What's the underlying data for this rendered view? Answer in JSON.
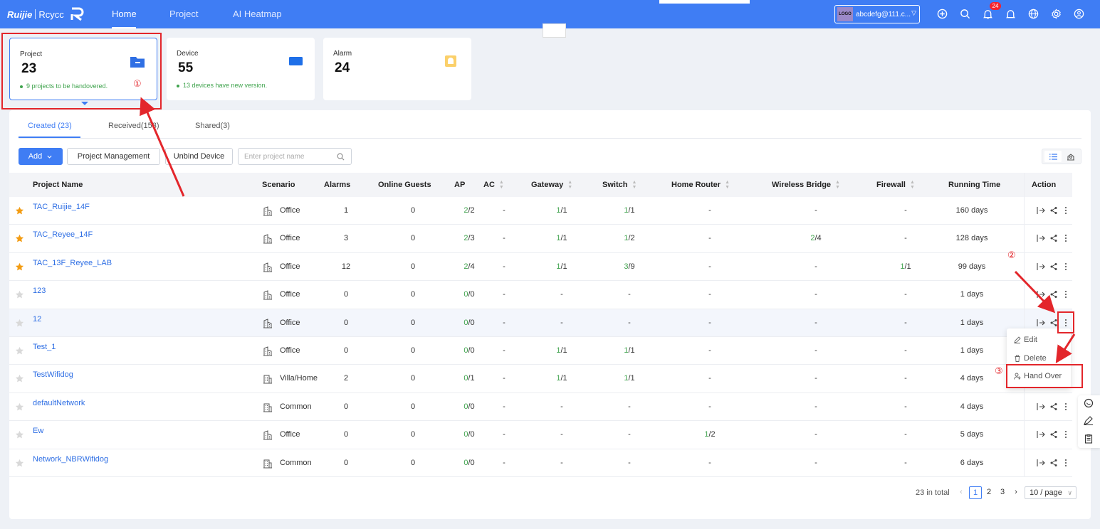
{
  "brand": {
    "ruijie": "Ruijie",
    "reyee": "Rcycc"
  },
  "nav": {
    "tabs": [
      {
        "label": "Home"
      },
      {
        "label": "Project"
      },
      {
        "label": "AI Heatmap"
      }
    ]
  },
  "account": {
    "logo": "LOGO",
    "name": "abcdefg@111.c..."
  },
  "notifications": {
    "count": "24"
  },
  "cards": [
    {
      "label": "Project",
      "value": "23",
      "note": "9 projects to be handovered.",
      "icon": "folder-icon"
    },
    {
      "label": "Device",
      "value": "55",
      "note": "13 devices have new version.",
      "icon": "device-icon"
    },
    {
      "label": "Alarm",
      "value": "24",
      "note": "",
      "icon": "alarm-bell-icon"
    }
  ],
  "tabs": [
    {
      "label": "Created (23)"
    },
    {
      "label": "Received(153)"
    },
    {
      "label": "Shared(3)"
    }
  ],
  "toolbar": {
    "add": "Add",
    "project_management": "Project Management",
    "unbind_device": "Unbind Device",
    "search_placeholder": "Enter project name"
  },
  "table": {
    "headers": {
      "project_name": "Project Name",
      "scenario": "Scenario",
      "alarms": "Alarms",
      "online_guests": "Online Guests",
      "ap": "AP",
      "ac": "AC",
      "gateway": "Gateway",
      "switch": "Switch",
      "home_router": "Home Router",
      "wireless_bridge": "Wireless Bridge",
      "firewall": "Firewall",
      "running_time": "Running Time",
      "action": "Action"
    },
    "rows": [
      {
        "starred": true,
        "name": "TAC_Ruijie_14F",
        "scenario": "Office",
        "alarms": "1",
        "guests": "0",
        "ap": [
          "2",
          "/2"
        ],
        "ac": "-",
        "gateway": [
          "1",
          "/1"
        ],
        "switch": [
          "1",
          "/1"
        ],
        "home_router": [
          "-",
          ""
        ],
        "bridge": [
          "-",
          ""
        ],
        "firewall": [
          "-",
          ""
        ],
        "running": "160 days"
      },
      {
        "starred": true,
        "name": "TAC_Reyee_14F",
        "scenario": "Office",
        "alarms": "3",
        "guests": "0",
        "ap": [
          "2",
          "/3"
        ],
        "ac": "-",
        "gateway": [
          "1",
          "/1"
        ],
        "switch": [
          "1",
          "/2"
        ],
        "home_router": [
          "-",
          ""
        ],
        "bridge": [
          "2",
          "/4"
        ],
        "firewall": [
          "-",
          ""
        ],
        "running": "128 days"
      },
      {
        "starred": true,
        "name": "TAC_13F_Reyee_LAB",
        "scenario": "Office",
        "alarms": "12",
        "guests": "0",
        "ap": [
          "2",
          "/4"
        ],
        "ac": "-",
        "gateway": [
          "1",
          "/1"
        ],
        "switch": [
          "3",
          "/9"
        ],
        "home_router": [
          "-",
          ""
        ],
        "bridge": [
          "-",
          ""
        ],
        "firewall": [
          "1",
          "/1"
        ],
        "running": "99 days"
      },
      {
        "starred": false,
        "name": "123",
        "scenario": "Office",
        "alarms": "0",
        "guests": "0",
        "ap": [
          "0",
          "/0"
        ],
        "ac": "-",
        "gateway": [
          "-",
          ""
        ],
        "switch": [
          "-",
          ""
        ],
        "home_router": [
          "-",
          ""
        ],
        "bridge": [
          "-",
          ""
        ],
        "firewall": [
          "-",
          ""
        ],
        "running": "1 days"
      },
      {
        "starred": false,
        "name": "12",
        "scenario": "Office",
        "alarms": "0",
        "guests": "0",
        "ap": [
          "0",
          "/0"
        ],
        "ac": "-",
        "gateway": [
          "-",
          ""
        ],
        "switch": [
          "-",
          ""
        ],
        "home_router": [
          "-",
          ""
        ],
        "bridge": [
          "-",
          ""
        ],
        "firewall": [
          "-",
          ""
        ],
        "running": "1 days"
      },
      {
        "starred": false,
        "name": "Test_1",
        "scenario": "Office",
        "alarms": "0",
        "guests": "0",
        "ap": [
          "0",
          "/0"
        ],
        "ac": "-",
        "gateway": [
          "1",
          "/1"
        ],
        "switch": [
          "1",
          "/1"
        ],
        "home_router": [
          "-",
          ""
        ],
        "bridge": [
          "-",
          ""
        ],
        "firewall": [
          "-",
          ""
        ],
        "running": "1 days"
      },
      {
        "starred": false,
        "name": "TestWifidog",
        "scenario": "Villa/Home",
        "alarms": "2",
        "guests": "0",
        "ap": [
          "0",
          "/1"
        ],
        "ac": "-",
        "gateway": [
          "1",
          "/1"
        ],
        "switch": [
          "1",
          "/1"
        ],
        "home_router": [
          "-",
          ""
        ],
        "bridge": [
          "-",
          ""
        ],
        "firewall": [
          "-",
          ""
        ],
        "running": "4 days"
      },
      {
        "starred": false,
        "name": "defaultNetwork",
        "scenario": "Common",
        "alarms": "0",
        "guests": "0",
        "ap": [
          "0",
          "/0"
        ],
        "ac": "-",
        "gateway": [
          "-",
          ""
        ],
        "switch": [
          "-",
          ""
        ],
        "home_router": [
          "-",
          ""
        ],
        "bridge": [
          "-",
          ""
        ],
        "firewall": [
          "-",
          ""
        ],
        "running": "4 days"
      },
      {
        "starred": false,
        "name": "Ew",
        "scenario": "Office",
        "alarms": "0",
        "guests": "0",
        "ap": [
          "0",
          "/0"
        ],
        "ac": "-",
        "gateway": [
          "-",
          ""
        ],
        "switch": [
          "-",
          ""
        ],
        "home_router": [
          "1",
          "/2"
        ],
        "bridge": [
          "-",
          ""
        ],
        "firewall": [
          "-",
          ""
        ],
        "running": "5 days"
      },
      {
        "starred": false,
        "name": "Network_NBRWifidog",
        "scenario": "Common",
        "alarms": "0",
        "guests": "0",
        "ap": [
          "0",
          "/0"
        ],
        "ac": "-",
        "gateway": [
          "-",
          ""
        ],
        "switch": [
          "-",
          ""
        ],
        "home_router": [
          "-",
          ""
        ],
        "bridge": [
          "-",
          ""
        ],
        "firewall": [
          "-",
          ""
        ],
        "running": "6 days"
      }
    ]
  },
  "menu": {
    "edit": "Edit",
    "delete": "Delete",
    "hand_over": "Hand Over"
  },
  "pagination": {
    "total": "23 in total",
    "pages": [
      "1",
      "2",
      "3"
    ],
    "page_size": "10 / page"
  },
  "annotations": [
    "①",
    "②",
    "③"
  ],
  "colors": {
    "primary": "#3f7df4",
    "green": "#3fa34d",
    "annotation": "#e3262b",
    "star": "#f39c12"
  }
}
